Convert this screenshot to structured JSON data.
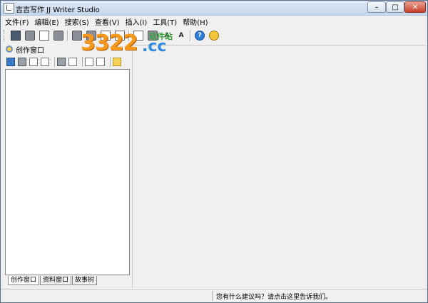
{
  "window": {
    "title": "吉吉写作 JJ Writer Studio",
    "minimize_glyph": "–",
    "maximize_glyph": "□",
    "close_glyph": "✕"
  },
  "menu": [
    "文件(F)",
    "编辑(E)",
    "搜索(S)",
    "查看(V)",
    "插入(I)",
    "工具(T)",
    "帮助(H)"
  ],
  "toolbar": {
    "icons": [
      "save-icon",
      "print-icon",
      "open-icon",
      "cut-icon",
      "undo-icon",
      "redo-icon",
      "paste-icon",
      "copy-icon",
      "format-icon",
      "font-icon",
      "font-size-icon",
      "help-icon",
      "bulb-icon"
    ],
    "font_glyph_a": "A",
    "font_glyph_b": "A",
    "help_glyph": "?"
  },
  "left_panel": {
    "title": "创作窗口",
    "tabs": [
      "创作窗口",
      "资料窗口",
      "故事树"
    ]
  },
  "status": {
    "text": "您有什么建议吗？请点击这里告诉我们。"
  },
  "watermark": {
    "number": "3322",
    "domain": ".cc",
    "subtitle": "软件站"
  }
}
